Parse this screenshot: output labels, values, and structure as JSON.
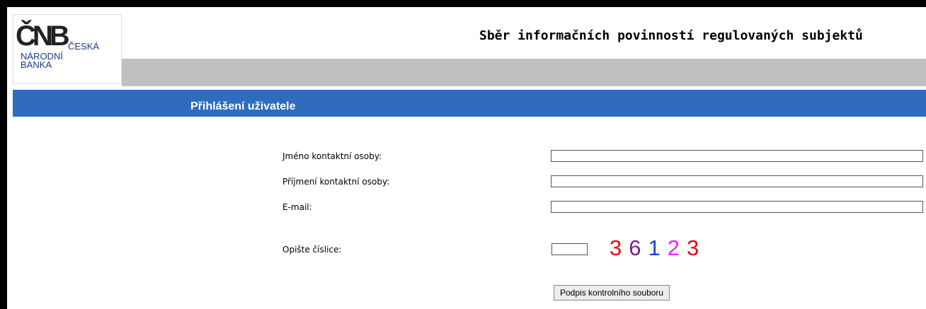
{
  "header": {
    "logo": {
      "mark": "ČNB",
      "line1": "ČESKÁ",
      "line2": "NÁRODNÍ",
      "line3": "BANKA"
    },
    "title": "Sběr informačních povinností regulovaných subjektů"
  },
  "section": {
    "heading": "Přihlášení uživatele"
  },
  "form": {
    "first_name_label": "Jméno kontaktní osoby:",
    "first_name_value": "",
    "last_name_label": "Příjmení kontaktní osoby:",
    "last_name_value": "",
    "email_label": "E-mail:",
    "email_value": "",
    "captcha_label": "Opište číslice:",
    "captcha_value": "",
    "captcha_digits": [
      {
        "digit": "3",
        "color": "#e8001a"
      },
      {
        "digit": "6",
        "color": "#7a1f8c"
      },
      {
        "digit": "1",
        "color": "#1c3cd8"
      },
      {
        "digit": "2",
        "color": "#ee22ee"
      },
      {
        "digit": "3",
        "color": "#e8001a"
      }
    ],
    "submit_label": "Podpis kontrolního souboru"
  },
  "colors": {
    "blue_bar": "#2f6bbf",
    "gray_bar": "#c0c0c0"
  }
}
